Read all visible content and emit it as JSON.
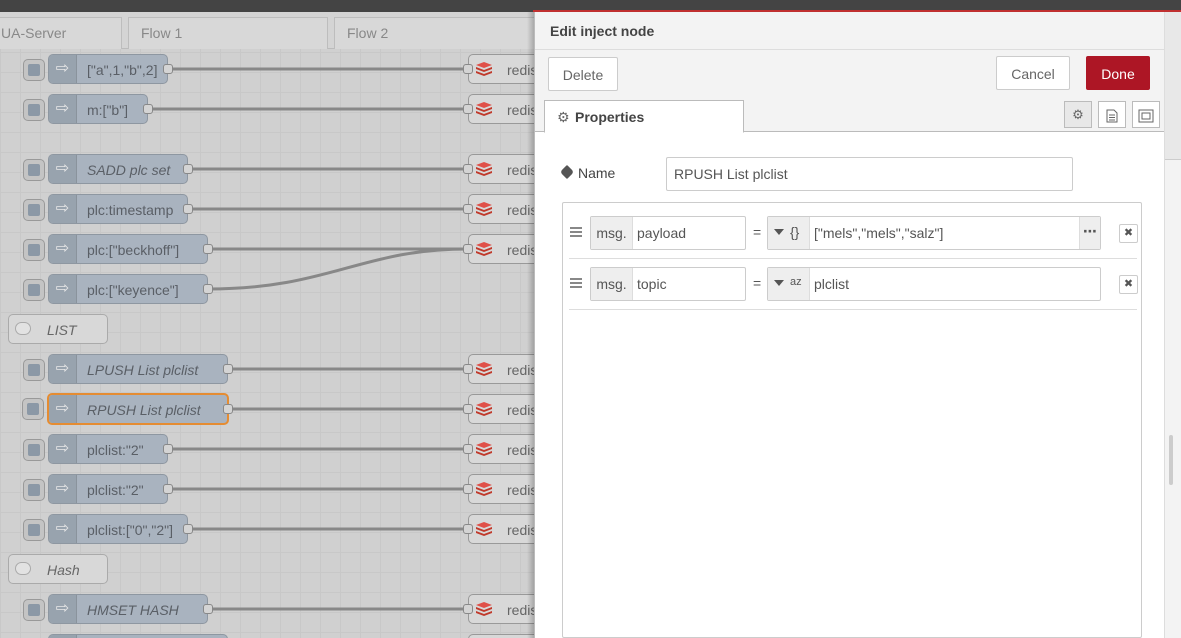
{
  "workspace": {
    "tabs": [
      {
        "label": "UA-Server"
      },
      {
        "label": "Flow 1"
      },
      {
        "label": "Flow 2"
      }
    ],
    "inject_nodes": [
      {
        "label": "[\"a\",1,\"b\",2]",
        "italic": false
      },
      {
        "label": "m:[\"b\"]",
        "italic": false
      },
      {
        "label": "SADD plc set",
        "italic": true
      },
      {
        "label": "plc:timestamp",
        "italic": false
      },
      {
        "label": "plc:[\"beckhoff\"]",
        "italic": false
      },
      {
        "label": "plc:[\"keyence\"]",
        "italic": false
      },
      {
        "label": "LPUSH List plclist",
        "italic": true
      },
      {
        "label": "RPUSH List plclist",
        "italic": true
      },
      {
        "label": "plclist:\"2\"",
        "italic": false
      },
      {
        "label": "plclist:\"2\"",
        "italic": false
      },
      {
        "label": "plclist:[\"0\",\"2\"]",
        "italic": false
      },
      {
        "label": "HMSET HASH",
        "italic": true
      }
    ],
    "comments": [
      {
        "label": "LIST"
      },
      {
        "label": "Hash"
      }
    ],
    "redis_label": "redis"
  },
  "tray": {
    "title": "Edit inject node",
    "delete_label": "Delete",
    "cancel_label": "Cancel",
    "done_label": "Done",
    "properties_tab": "Properties",
    "name_label": "Name",
    "name_value": "RPUSH List plclist",
    "props": [
      {
        "prefix": "msg.",
        "property": "payload",
        "type_symbol": "{}",
        "value": "[\"mels\",\"mels\",\"salz\"]"
      },
      {
        "prefix": "msg.",
        "property": "topic",
        "type_symbol": "az",
        "value": "plclist"
      }
    ],
    "equals": "=",
    "delete_row_symbol": "✖",
    "more_symbol": "⋯"
  },
  "colors": {
    "primary": "#ad1625",
    "selected_outline": "#e58c32",
    "node_fill": "#a9b3bf"
  }
}
